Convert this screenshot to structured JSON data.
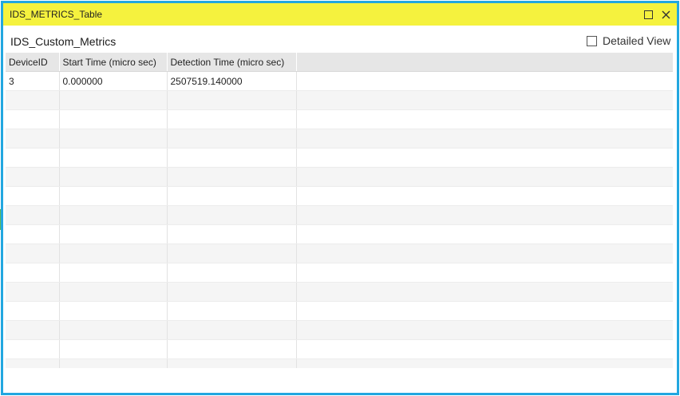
{
  "window": {
    "title": "IDS_METRICS_Table",
    "titlebar_color": "#f5f23e",
    "border_color": "#22a7e0",
    "controls": [
      "maximize-icon",
      "close-icon"
    ]
  },
  "view": {
    "title": "IDS_Custom_Metrics",
    "detailed_view_label": "Detailed View",
    "detailed_view_checked": false
  },
  "table": {
    "columns": [
      "DeviceID",
      "Start Time (micro sec)",
      "Detection Time (micro sec)",
      ""
    ],
    "rows": [
      [
        "3",
        "0.000000",
        "2507519.140000",
        ""
      ],
      [
        "",
        "",
        "",
        ""
      ],
      [
        "",
        "",
        "",
        ""
      ],
      [
        "",
        "",
        "",
        ""
      ],
      [
        "",
        "",
        "",
        ""
      ],
      [
        "",
        "",
        "",
        ""
      ],
      [
        "",
        "",
        "",
        ""
      ],
      [
        "",
        "",
        "",
        ""
      ],
      [
        "",
        "",
        "",
        ""
      ],
      [
        "",
        "",
        "",
        ""
      ],
      [
        "",
        "",
        "",
        ""
      ],
      [
        "",
        "",
        "",
        ""
      ],
      [
        "",
        "",
        "",
        ""
      ],
      [
        "",
        "",
        "",
        ""
      ],
      [
        "",
        "",
        "",
        ""
      ],
      [
        "",
        "",
        "",
        ""
      ]
    ]
  }
}
